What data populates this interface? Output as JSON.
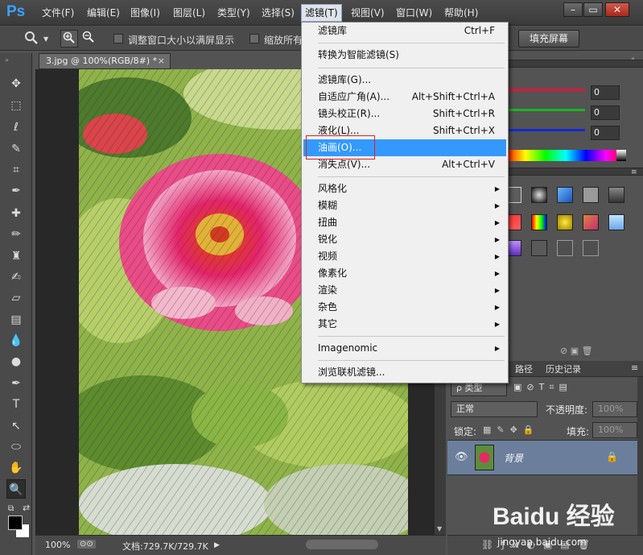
{
  "app": {
    "logo": "Ps",
    "menus": [
      "文件(F)",
      "编辑(E)",
      "图像(I)",
      "图层(L)",
      "类型(Y)",
      "选择(S)",
      "滤镜(T)",
      "视图(V)",
      "窗口(W)",
      "帮助(H)"
    ],
    "active_menu": "滤镜(T)",
    "window_buttons": [
      "minimize",
      "restore",
      "close"
    ]
  },
  "options_bar": {
    "tool_icon": "zoom-tool-icon",
    "zoom_in": "zoom-in-icon",
    "zoom_out": "zoom-out-icon",
    "resize_label": "调整窗口大小以满屏显示",
    "zoom_all_label": "缩放所有",
    "fill_screen_label": "填充屏幕",
    "fill_screen_checked": false
  },
  "document": {
    "tab_title": "3.jpg @ 100%(RGB/8#) *",
    "close": "×",
    "zoom": "100%",
    "doc_info": "文档:729.7K/729.7K"
  },
  "filter_menu": {
    "items": [
      {
        "label": "滤镜库",
        "shortcut": "Ctrl+F"
      },
      {
        "label": "转换为智能滤镜(S)"
      },
      {
        "label": "滤镜库(G)..."
      },
      {
        "label": "自适应广角(A)...",
        "shortcut": "Alt+Shift+Ctrl+A"
      },
      {
        "label": "镜头校正(R)...",
        "shortcut": "Shift+Ctrl+R"
      },
      {
        "label": "液化(L)...",
        "shortcut": "Shift+Ctrl+X"
      },
      {
        "label": "油画(O)...",
        "highlighted": true
      },
      {
        "label": "消失点(V)...",
        "shortcut": "Alt+Ctrl+V"
      },
      {
        "label": "风格化",
        "submenu": true
      },
      {
        "label": "模糊",
        "submenu": true
      },
      {
        "label": "扭曲",
        "submenu": true
      },
      {
        "label": "锐化",
        "submenu": true
      },
      {
        "label": "视频",
        "submenu": true
      },
      {
        "label": "像素化",
        "submenu": true
      },
      {
        "label": "渲染",
        "submenu": true
      },
      {
        "label": "杂色",
        "submenu": true
      },
      {
        "label": "其它",
        "submenu": true
      },
      {
        "label": "Imagenomic",
        "submenu": true
      },
      {
        "label": "浏览联机滤镜..."
      }
    ]
  },
  "color_panel": {
    "r": "0",
    "g": "0",
    "b": "0",
    "r_color": "#e0143c",
    "g_color": "#18b424",
    "b_color": "#1428d8"
  },
  "layers_panel": {
    "tabs": [
      "路径",
      "历史记录"
    ],
    "filter_label": "ρ 类型",
    "blend_mode": "正常",
    "opacity_label": "不透明度:",
    "opacity_value": "100%",
    "lock_label": "锁定:",
    "fill_label": "填充:",
    "fill_value": "100%",
    "layer_name": "背景"
  },
  "watermark": {
    "logo_text": "Baidu 经验",
    "url": "jingyan.baidu.com"
  }
}
